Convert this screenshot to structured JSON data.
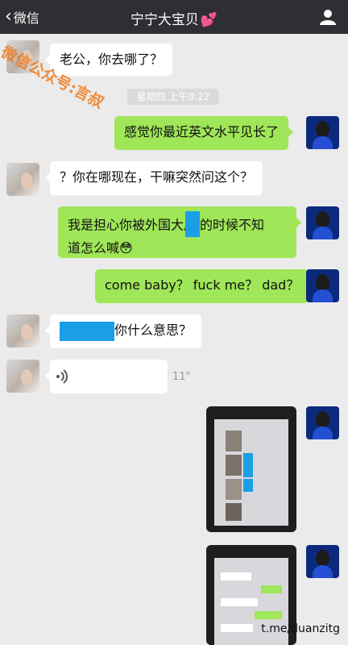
{
  "nav": {
    "back_label": "微信",
    "title": "宁宁大宝贝",
    "title_emoji": "💕"
  },
  "timestamp": "星期四 上午8:22",
  "messages": [
    {
      "side": "in",
      "text": "老公，你去哪了？"
    },
    {
      "side": "out",
      "text": "感觉你最近英文水平见长了"
    },
    {
      "side": "in",
      "text": "？你在哪现在，干嘛突然问这个？"
    },
    {
      "side": "out",
      "text_a": "我是担心你被外国大屌",
      "text_b": "的时候不知",
      "text_c": "道怎么喊",
      "emoji": "😳"
    },
    {
      "side": "out",
      "text": "come baby？ fuck me？ dad？"
    },
    {
      "side": "in",
      "text": "你什么意思？"
    },
    {
      "side": "in",
      "voice_seconds": "11\""
    },
    {
      "side": "out",
      "type": "image"
    },
    {
      "side": "out",
      "type": "image"
    }
  ],
  "watermark": "微信公众号:言叔",
  "footer_link": "t.me/duanzitg",
  "colors": {
    "nav_bg": "#2e2e33",
    "out_bubble": "#9fe658",
    "in_bubble": "#ffffff",
    "chat_bg": "#ebebeb",
    "redact": "#1a9ee6"
  },
  "icons": {
    "back": "chevron-left-icon",
    "profile": "person-icon",
    "voice": "voice-wave-icon"
  }
}
